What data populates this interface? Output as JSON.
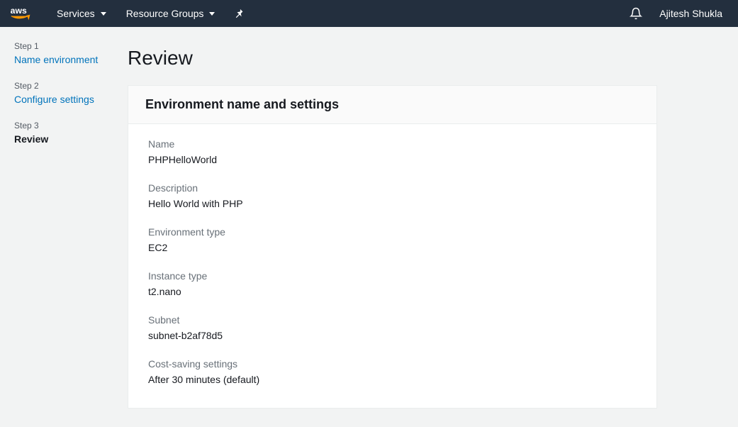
{
  "nav": {
    "services": "Services",
    "resource_groups": "Resource Groups",
    "user": "Ajitesh Shukla"
  },
  "sidebar": {
    "steps": [
      {
        "label": "Step 1",
        "title": "Name environment"
      },
      {
        "label": "Step 2",
        "title": "Configure settings"
      },
      {
        "label": "Step 3",
        "title": "Review"
      }
    ]
  },
  "page": {
    "title": "Review",
    "panel_header": "Environment name and settings",
    "fields": [
      {
        "label": "Name",
        "value": "PHPHelloWorld"
      },
      {
        "label": "Description",
        "value": "Hello World with PHP"
      },
      {
        "label": "Environment type",
        "value": "EC2"
      },
      {
        "label": "Instance type",
        "value": "t2.nano"
      },
      {
        "label": "Subnet",
        "value": "subnet-b2af78d5"
      },
      {
        "label": "Cost-saving settings",
        "value": "After 30 minutes (default)"
      }
    ]
  }
}
